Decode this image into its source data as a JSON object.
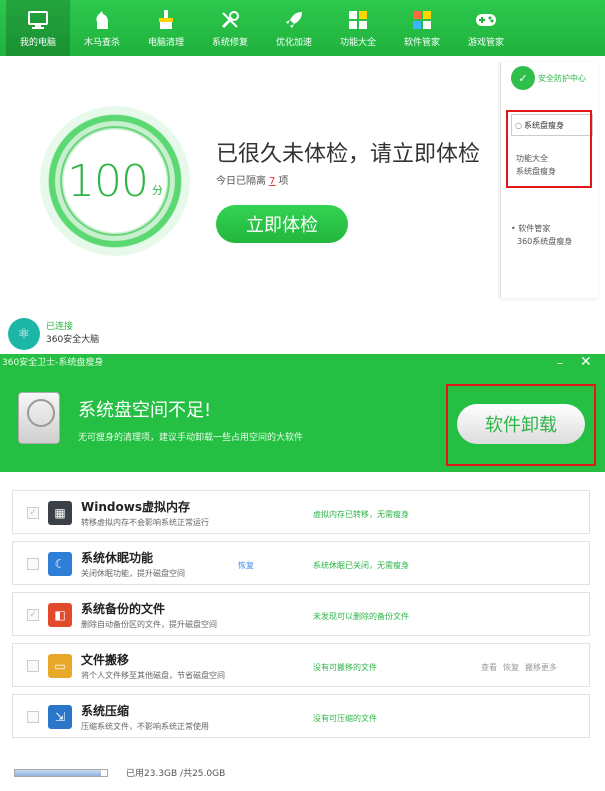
{
  "nav": {
    "items": [
      {
        "label": "我的电脑",
        "icon": "monitor-icon",
        "active": true
      },
      {
        "label": "木马查杀",
        "icon": "horse-icon",
        "active": false
      },
      {
        "label": "电脑清理",
        "icon": "broom-icon",
        "active": false
      },
      {
        "label": "系统修复",
        "icon": "wrench-icon",
        "active": false
      },
      {
        "label": "优化加速",
        "icon": "rocket-icon",
        "active": false
      },
      {
        "label": "功能大全",
        "icon": "grid-icon",
        "active": false
      },
      {
        "label": "软件管家",
        "icon": "apps-icon",
        "active": false
      },
      {
        "label": "游戏管家",
        "icon": "gamepad-icon",
        "active": false
      }
    ]
  },
  "check": {
    "score": "100",
    "score_unit": "分",
    "headline": "已很久未体检，请立即体检",
    "sub_prefix": "今日已隔离",
    "sub_count": "7",
    "sub_suffix": "项",
    "button": "立即体检"
  },
  "brain": {
    "status": "已连接",
    "name": "360安全大脑"
  },
  "side": {
    "safe_label": "安全防护中心",
    "search_value": "系统盘瘦身",
    "result_group": "功能大全",
    "result_item": "系统盘瘦身",
    "group2": "• 软件管家",
    "group2_item": "360系统盘瘦身"
  },
  "dialog": {
    "title": "360安全卫士-系统盘瘦身",
    "minimize": "–",
    "close": "✕",
    "heading": "系统盘空间不足!",
    "sub": "无可瘦身的清理项，建议手动卸载一些占用空间的大软件",
    "button": "软件卸载"
  },
  "rows": [
    {
      "title": "Windows虚拟内存",
      "desc": "转移虚拟内存不会影响系统正常运行",
      "status": "虚拟内存已转移，无需瘦身",
      "checked": true,
      "icon": "memory-icon",
      "color": "#3b3f46",
      "link": "",
      "actions": ""
    },
    {
      "title": "系统休眠功能",
      "desc": "关闭休眠功能，提升磁盘空间",
      "status": "系统休眠已关闭，无需瘦身",
      "checked": false,
      "icon": "sleep-icon",
      "color": "#2d7fd8",
      "link": "恢复",
      "actions": ""
    },
    {
      "title": "系统备份的文件",
      "desc": "删除自动备份区的文件，提升磁盘空间",
      "status": "未发现可以删除的备份文件",
      "checked": true,
      "icon": "backup-icon",
      "color": "#e24a2c",
      "link": "",
      "actions": ""
    },
    {
      "title": "文件搬移",
      "desc": "将个人文件移至其他磁盘，节省磁盘空间",
      "status": "没有可搬移的文件",
      "checked": false,
      "icon": "folder-icon",
      "color": "#e8a92a",
      "link": "",
      "actions": "查看 恢复 搬移更多"
    },
    {
      "title": "系统压缩",
      "desc": "压缩系统文件，不影响系统正常使用",
      "status": "没有可压缩的文件",
      "checked": false,
      "icon": "compress-icon",
      "color": "#2a77c9",
      "link": "",
      "actions": ""
    }
  ],
  "footer": {
    "usage_text": "已用23.3GB /共25.0GB",
    "used_gb": 23.3,
    "total_gb": 25.0
  }
}
